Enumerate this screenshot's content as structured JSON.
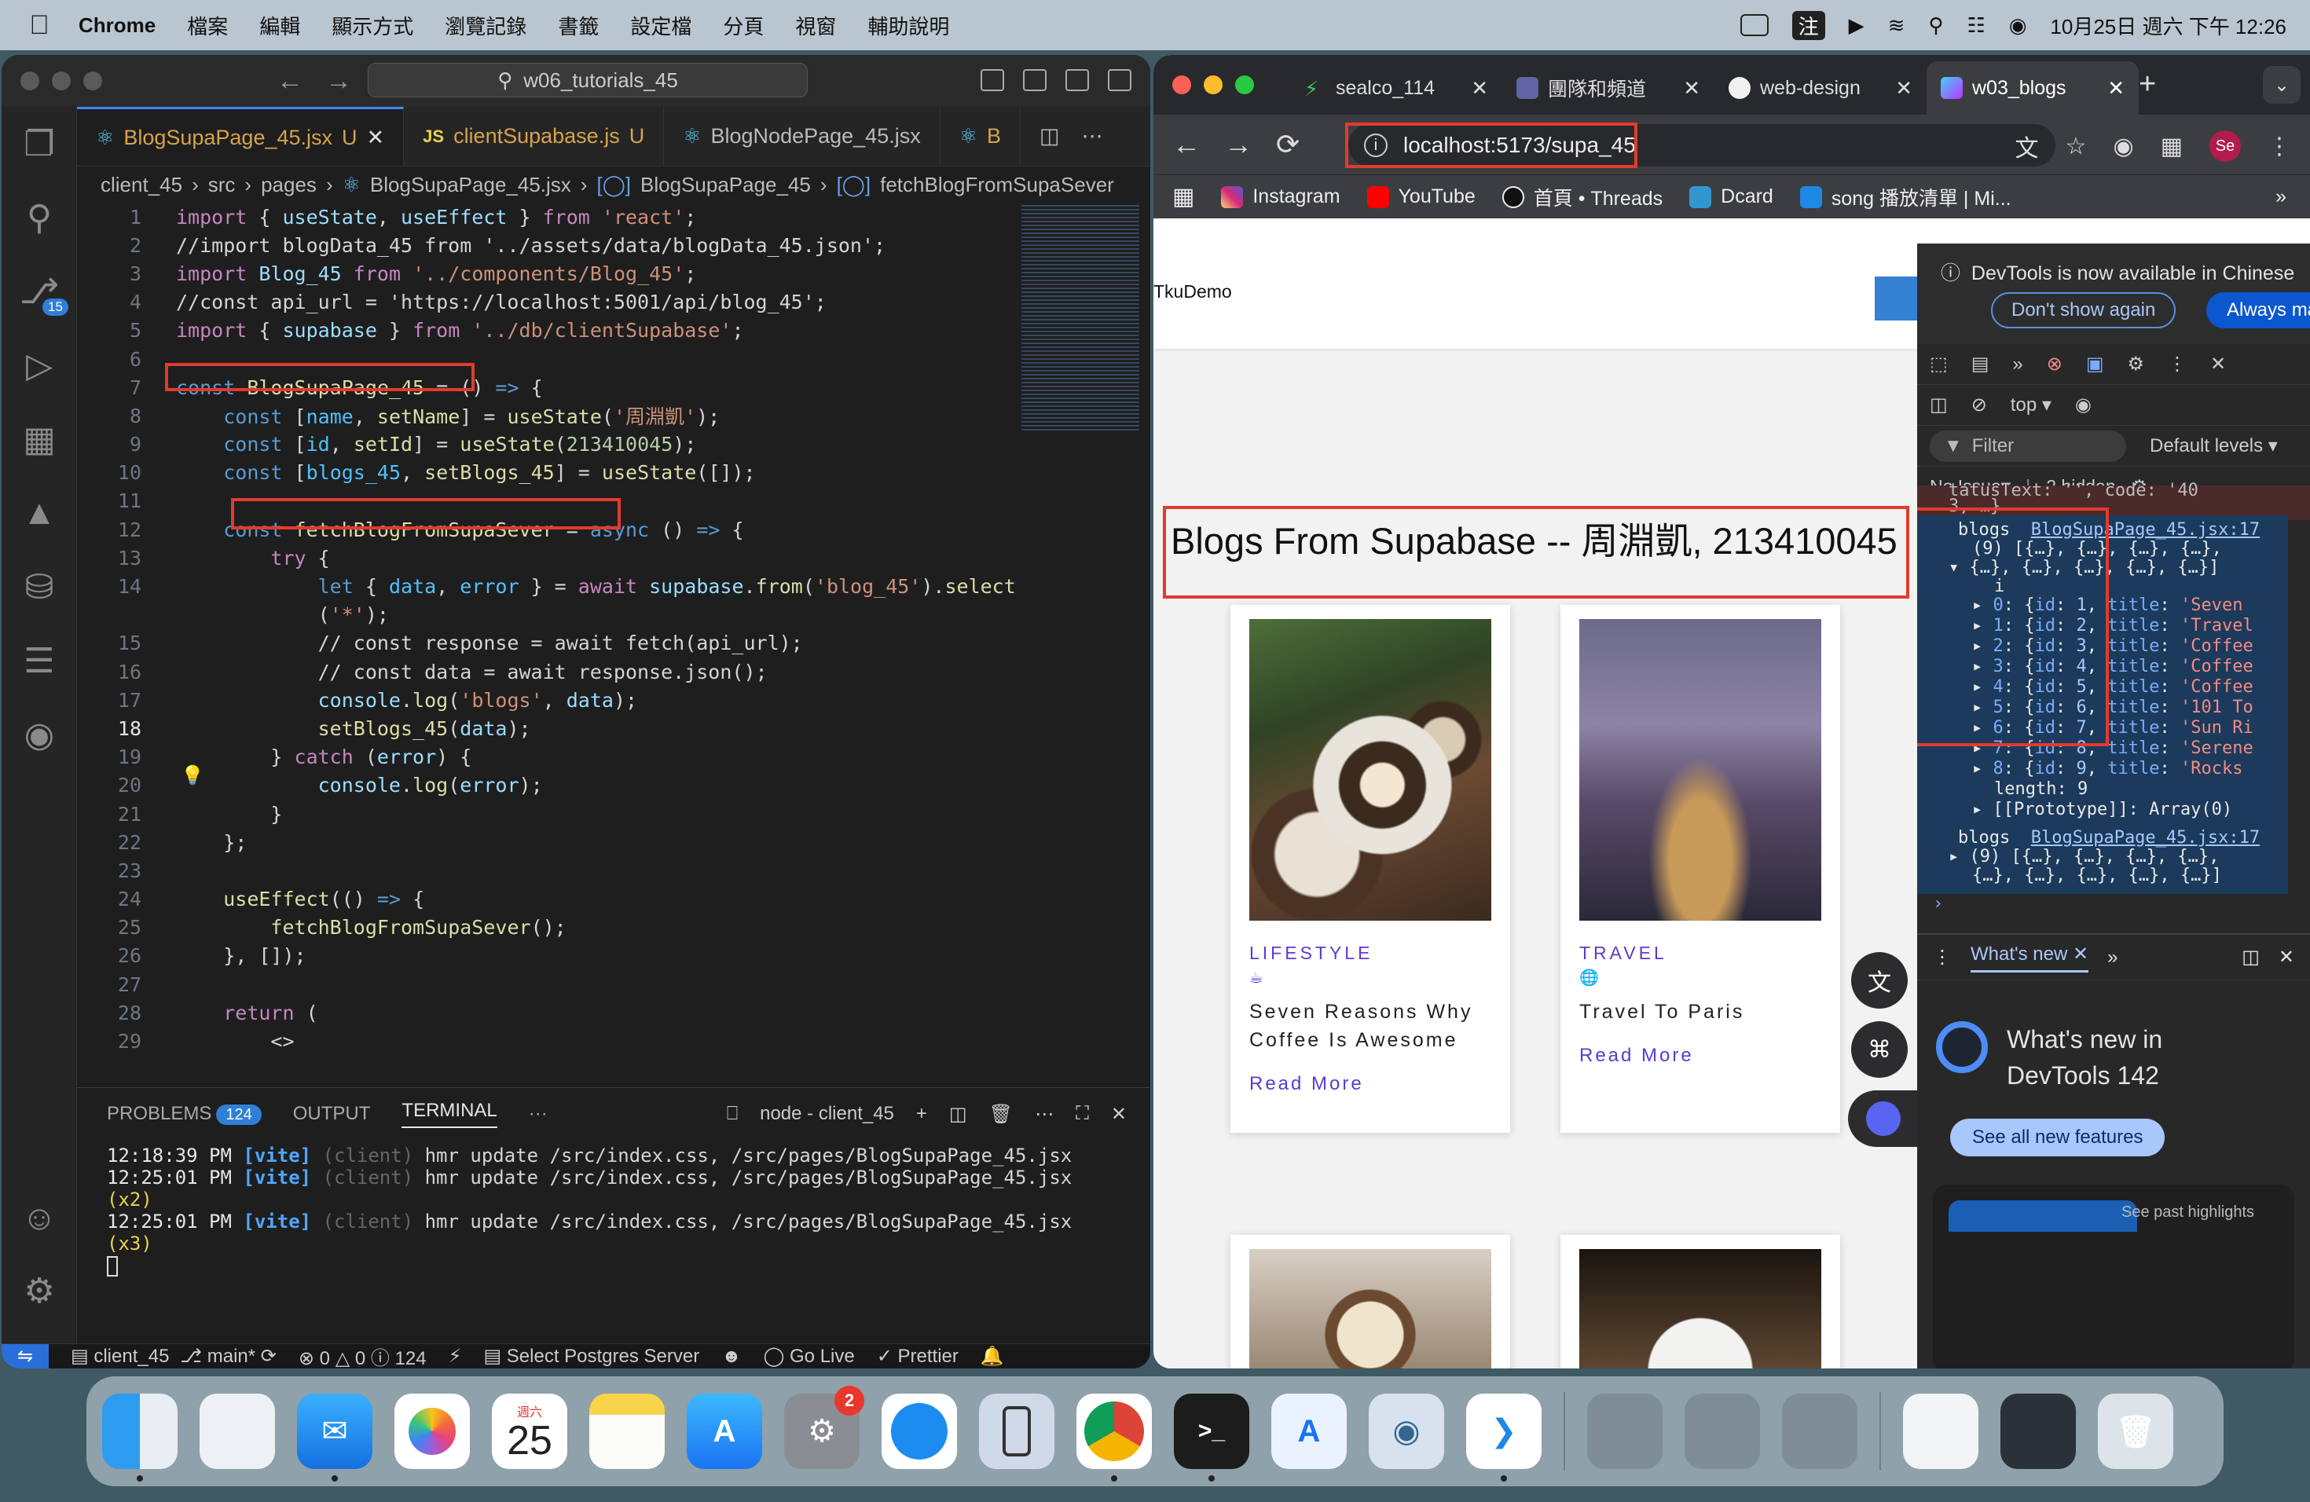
{
  "menubar": {
    "items": [
      "Chrome",
      "檔案",
      "編輯",
      "顯示方式",
      "瀏覽記錄",
      "書籤",
      "設定檔",
      "分頁",
      "視窗",
      "輔助說明"
    ],
    "input_method": "注",
    "datetime": "10月25日 週六 下午 12:26"
  },
  "vscode": {
    "search": "w06_tutorials_45",
    "tabs": [
      {
        "label": "BlogSupaPage_45.jsx",
        "badge": "U",
        "active": true
      },
      {
        "label": "clientSupabase.js",
        "badge": "U",
        "active": false
      },
      {
        "label": "BlogNodePage_45.jsx",
        "badge": "",
        "active": false
      },
      {
        "label": "B",
        "badge": "",
        "active": false
      }
    ],
    "breadcrumb": [
      "client_45",
      "src",
      "pages",
      "BlogSupaPage_45.jsx",
      "BlogSupaPage_45",
      "fetchBlogFromSupaSever"
    ],
    "source_control_badge": "15",
    "panel": {
      "tabs": [
        "PROBLEMS",
        "OUTPUT",
        "TERMINAL",
        "···"
      ],
      "problems_count": "124",
      "terminal_name": "node - client_45",
      "lines": [
        {
          "time": "12:18:39 PM",
          "tag": "[vite]",
          "src": "(client)",
          "msg": "hmr update /src/index.css, /src/pages/BlogSupaPage_45.jsx",
          "mult": ""
        },
        {
          "time": "12:25:01 PM",
          "tag": "[vite]",
          "src": "(client)",
          "msg": "hmr update /src/index.css, /src/pages/BlogSupaPage_45.jsx",
          "mult": "(x2)"
        },
        {
          "time": "12:25:01 PM",
          "tag": "[vite]",
          "src": "(client)",
          "msg": "hmr update /src/index.css, /src/pages/BlogSupaPage_45.jsx",
          "mult": "(x3)"
        }
      ]
    },
    "status": {
      "folder": "client_45",
      "branch": "main*",
      "errors": "0",
      "warnings": "0",
      "info": "124",
      "postgres": "Select Postgres Server",
      "golive": "Go Live",
      "prettier": "Prettier"
    }
  },
  "chrome": {
    "tabs": [
      {
        "title": "sealco_114",
        "color": "#34c759"
      },
      {
        "title": "團隊和頻道",
        "color": "#6264a7"
      },
      {
        "title": "web-design",
        "color": "#f0f0f0"
      },
      {
        "title": "w03_blogs",
        "color": "#bd34fe"
      }
    ],
    "url": "localhost:5173/supa_45",
    "bookmarks": [
      {
        "label": "Instagram",
        "color": "#d6249f"
      },
      {
        "label": "YouTube",
        "color": "#ff0000"
      },
      {
        "label": "首頁 • Threads",
        "color": "#111111"
      },
      {
        "label": "Dcard",
        "color": "#3397cf"
      },
      {
        "label": "song 播放清單 | Mi...",
        "color": "#1e88e5"
      }
    ],
    "profile": "Se",
    "page": {
      "brand": "TkuDemo",
      "heading": "Blogs From Supabase -- 周淵凱, 213410045",
      "cards": [
        {
          "category": "LIFESTYLE",
          "title": "Seven Reasons Why Coffee Is Awesome",
          "read_more": "Read More"
        },
        {
          "category": "TRAVEL",
          "title": "Travel To Paris",
          "read_more": "Read More"
        }
      ]
    },
    "devtools": {
      "banner": "DevTools is now available in Chinese",
      "dont_show": "Don't show again",
      "always": "Always match Chrome's language",
      "context": "top",
      "filter": "Filter",
      "levels": "Default levels",
      "issues": "No Issues",
      "hidden": "2 hidden",
      "console": {
        "trunc1": "tatusText: '', code: '40",
        "trunc2": "3, …}",
        "log_label": "blogs",
        "log_src": "BlogSupaPage_45.jsx:17",
        "arr_head": "(9) [{…}, {…}, {…}, {…},",
        "arr_head2": "{…}, {…}, {…}, {…}, {…}]",
        "items": [
          {
            "idx": "0",
            "id": "1",
            "title": "'Seven"
          },
          {
            "idx": "1",
            "id": "2",
            "title": "'Travel"
          },
          {
            "idx": "2",
            "id": "3",
            "title": "'Coffee"
          },
          {
            "idx": "3",
            "id": "4",
            "title": "'Coffee"
          },
          {
            "idx": "4",
            "id": "5",
            "title": "'Coffee"
          },
          {
            "idx": "5",
            "id": "6",
            "title": "'101 To"
          },
          {
            "idx": "6",
            "id": "7",
            "title": "'Sun Ri"
          },
          {
            "idx": "7",
            "id": "8",
            "title": "'Serene"
          },
          {
            "idx": "8",
            "id": "9",
            "title": "'Rocks"
          }
        ],
        "length": "length: 9",
        "proto": "[[Prototype]]: Array(0)"
      },
      "whatsnew_tab": "What's new",
      "whatsnew_title1": "What's new in",
      "whatsnew_title2": "DevTools 142",
      "whatsnew_btn": "See all new features",
      "whatsnew_next": "See past highlights"
    }
  },
  "dock": {
    "calendar_day": "25",
    "calendar_weekday": "週六",
    "settings_badge": "2"
  }
}
